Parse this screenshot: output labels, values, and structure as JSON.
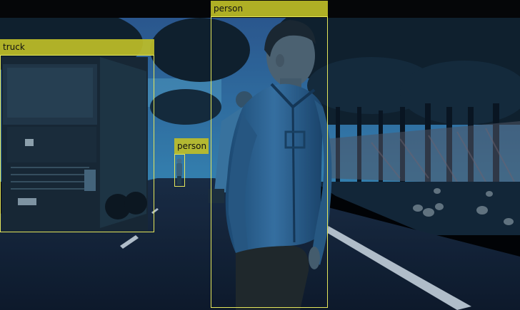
{
  "detections": [
    {
      "label": "truck"
    },
    {
      "label": "person"
    },
    {
      "label": "person"
    }
  ],
  "colors": {
    "box_outline": "#e4e65a",
    "label_fill": "#bebe28",
    "label_text": "#111111"
  }
}
